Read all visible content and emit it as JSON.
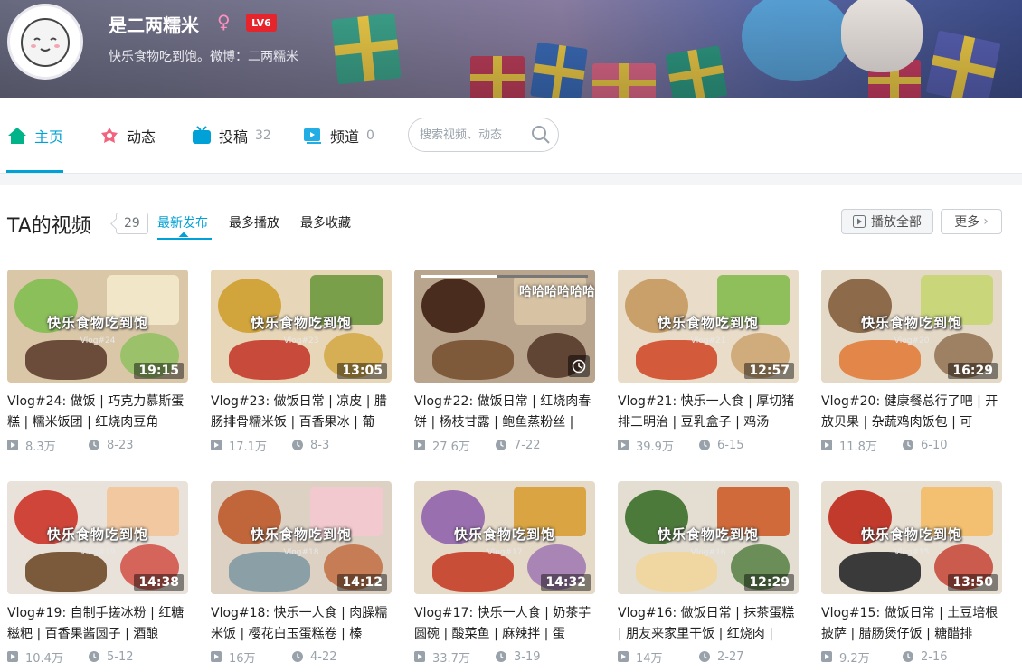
{
  "profile": {
    "username": "是二两糯米",
    "gender_symbol": "♀",
    "level": "LV6",
    "signature": "快乐食物吃到饱。微博：二两糯米"
  },
  "nav": {
    "home": {
      "label": "主页"
    },
    "dynamic": {
      "label": "动态"
    },
    "posts": {
      "label": "投稿",
      "count": "32"
    },
    "channels": {
      "label": "频道",
      "count": "0"
    }
  },
  "search": {
    "placeholder": "搜索视频、动态"
  },
  "section": {
    "title": "TA的视频",
    "count": "29",
    "sort_latest": "最新发布",
    "sort_most_played": "最多播放",
    "sort_most_fav": "最多收藏",
    "play_all": "播放全部",
    "more": "更多"
  },
  "colors": {
    "accent": "#00a1d6",
    "level_badge": "#e5242b"
  },
  "videos": [
    {
      "title": "Vlog#24: 做饭 | 巧克力慕斯蛋糕 | 糯米饭团 | 红烧肉豆角",
      "views": "8.3万",
      "date": "8-23",
      "duration": "19:15",
      "overlay": "快乐食物吃到饱",
      "mark": "Vlog#24"
    },
    {
      "title": "Vlog#23: 做饭日常 | 凉皮 | 腊肠排骨糯米饭 | 百香果冰 | 葡",
      "views": "17.1万",
      "date": "8-3",
      "duration": "13:05",
      "overlay": "快乐食物吃到饱",
      "mark": "Vlog#23"
    },
    {
      "title": "Vlog#22: 做饭日常 | 红烧肉春饼 | 杨枝甘露 | 鲍鱼蒸粉丝 |",
      "views": "27.6万",
      "date": "7-22",
      "duration": "",
      "overlay": "哈哈哈哈哈哈",
      "mark": ""
    },
    {
      "title": "Vlog#21: 快乐一人食 | 厚切猪排三明治 | 豆乳盒子 | 鸡汤",
      "views": "39.9万",
      "date": "6-15",
      "duration": "12:57",
      "overlay": "快乐食物吃到饱",
      "mark": "Vlog#21"
    },
    {
      "title": "Vlog#20: 健康餐总行了吧 | 开放贝果 | 杂蔬鸡肉饭包 | 可",
      "views": "11.8万",
      "date": "6-10",
      "duration": "16:29",
      "overlay": "快乐食物吃到饱",
      "mark": "Vlog#20"
    },
    {
      "title": "Vlog#19: 自制手搓冰粉 | 红糖糍粑 | 百香果酱圆子 | 酒酿",
      "views": "10.4万",
      "date": "5-12",
      "duration": "14:38",
      "overlay": "快乐食物吃到饱",
      "mark": "Vlog#19"
    },
    {
      "title": "Vlog#18: 快乐一人食 | 肉臊糯米饭 | 樱花白玉蛋糕卷 | 榛",
      "views": "16万",
      "date": "4-22",
      "duration": "14:12",
      "overlay": "快乐食物吃到饱",
      "mark": "Vlog#18"
    },
    {
      "title": "Vlog#17: 快乐一人食 | 奶茶芋圆碗 | 酸菜鱼 | 麻辣拌 | 蛋",
      "views": "33.7万",
      "date": "3-19",
      "duration": "14:32",
      "overlay": "快乐食物吃到饱",
      "mark": "Vlog#17"
    },
    {
      "title": "Vlog#16: 做饭日常 | 抹茶蛋糕 | 朋友来家里干饭 | 红烧肉 |",
      "views": "14万",
      "date": "2-27",
      "duration": "12:29",
      "overlay": "快乐食物吃到饱",
      "mark": "Vlog#16"
    },
    {
      "title": "Vlog#15: 做饭日常 | 土豆培根披萨 | 腊肠煲仔饭 | 糖醋排",
      "views": "9.2万",
      "date": "2-16",
      "duration": "13:50",
      "overlay": "快乐食物吃到饱",
      "mark": "Vlog#15"
    }
  ]
}
